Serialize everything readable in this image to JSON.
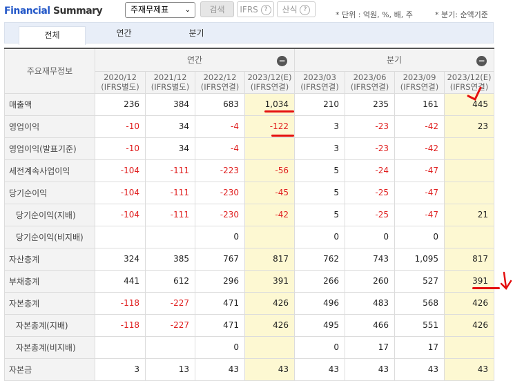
{
  "header": {
    "title_part1": "Financial",
    "title_part2": " Summary",
    "select_value": "주재무제표",
    "search_label": "검색",
    "ifrs_label": "IFRS",
    "formula_label": "산식",
    "help_icon": "?",
    "unit_note": "* 단위 : 억원, %, 배, 주",
    "quarter_note": "* 분기: 순액기준"
  },
  "tabs": [
    {
      "label": "전체",
      "active": true
    },
    {
      "label": "연간"
    },
    {
      "label": "분기"
    }
  ],
  "table": {
    "row_header": "주요재무정보",
    "annual_group": "연간",
    "quarter_group": "분기",
    "columns": [
      {
        "period": "2020/12",
        "basis": "(IFRS별도)"
      },
      {
        "period": "2021/12",
        "basis": "(IFRS별도)"
      },
      {
        "period": "2022/12",
        "basis": "(IFRS연결)"
      },
      {
        "period": "2023/12(E)",
        "basis": "(IFRS연결)",
        "estimate": true
      },
      {
        "period": "2023/03",
        "basis": "(IFRS연결)"
      },
      {
        "period": "2023/06",
        "basis": "(IFRS연결)"
      },
      {
        "period": "2023/09",
        "basis": "(IFRS연결)"
      },
      {
        "period": "2023/12(E)",
        "basis": "(IFRS연결)",
        "estimate": true
      }
    ],
    "rows": [
      {
        "label": "매출액",
        "values": [
          "236",
          "384",
          "683",
          "1,034",
          "210",
          "235",
          "161",
          "445"
        ]
      },
      {
        "label": "영업이익",
        "values": [
          "-10",
          "34",
          "-4",
          "-122",
          "3",
          "-23",
          "-42",
          "23"
        ]
      },
      {
        "label": "영업이익(발표기준)",
        "values": [
          "-10",
          "34",
          "-4",
          "",
          "3",
          "-23",
          "-42",
          ""
        ]
      },
      {
        "label": "세전계속사업이익",
        "values": [
          "-104",
          "-111",
          "-223",
          "-56",
          "5",
          "-24",
          "-47",
          ""
        ]
      },
      {
        "label": "당기순이익",
        "values": [
          "-104",
          "-111",
          "-230",
          "-45",
          "5",
          "-25",
          "-47",
          ""
        ]
      },
      {
        "label": "당기순이익(지배)",
        "indent": true,
        "values": [
          "-104",
          "-111",
          "-230",
          "-42",
          "5",
          "-25",
          "-47",
          "21"
        ]
      },
      {
        "label": "당기순이익(비지배)",
        "indent": true,
        "values": [
          "",
          "",
          "0",
          "",
          "0",
          "0",
          "0",
          ""
        ]
      },
      {
        "label": "자산총계",
        "values": [
          "324",
          "385",
          "767",
          "817",
          "762",
          "743",
          "1,095",
          "817"
        ]
      },
      {
        "label": "부채총계",
        "values": [
          "441",
          "612",
          "296",
          "391",
          "266",
          "260",
          "527",
          "391"
        ]
      },
      {
        "label": "자본총계",
        "values": [
          "-118",
          "-227",
          "471",
          "426",
          "496",
          "483",
          "568",
          "426"
        ]
      },
      {
        "label": "자본총계(지배)",
        "indent": true,
        "values": [
          "-118",
          "-227",
          "471",
          "426",
          "495",
          "466",
          "551",
          "426"
        ]
      },
      {
        "label": "자본총계(비지배)",
        "indent": true,
        "values": [
          "",
          "",
          "0",
          "",
          "0",
          "17",
          "17",
          ""
        ]
      },
      {
        "label": "자본금",
        "values": [
          "3",
          "13",
          "43",
          "43",
          "43",
          "43",
          "43",
          "43"
        ]
      }
    ]
  },
  "colors": {
    "negative": "#e02020",
    "estimate_bg": "#fdf8d2",
    "brand": "#2458c8",
    "annotation": "#e41010"
  }
}
